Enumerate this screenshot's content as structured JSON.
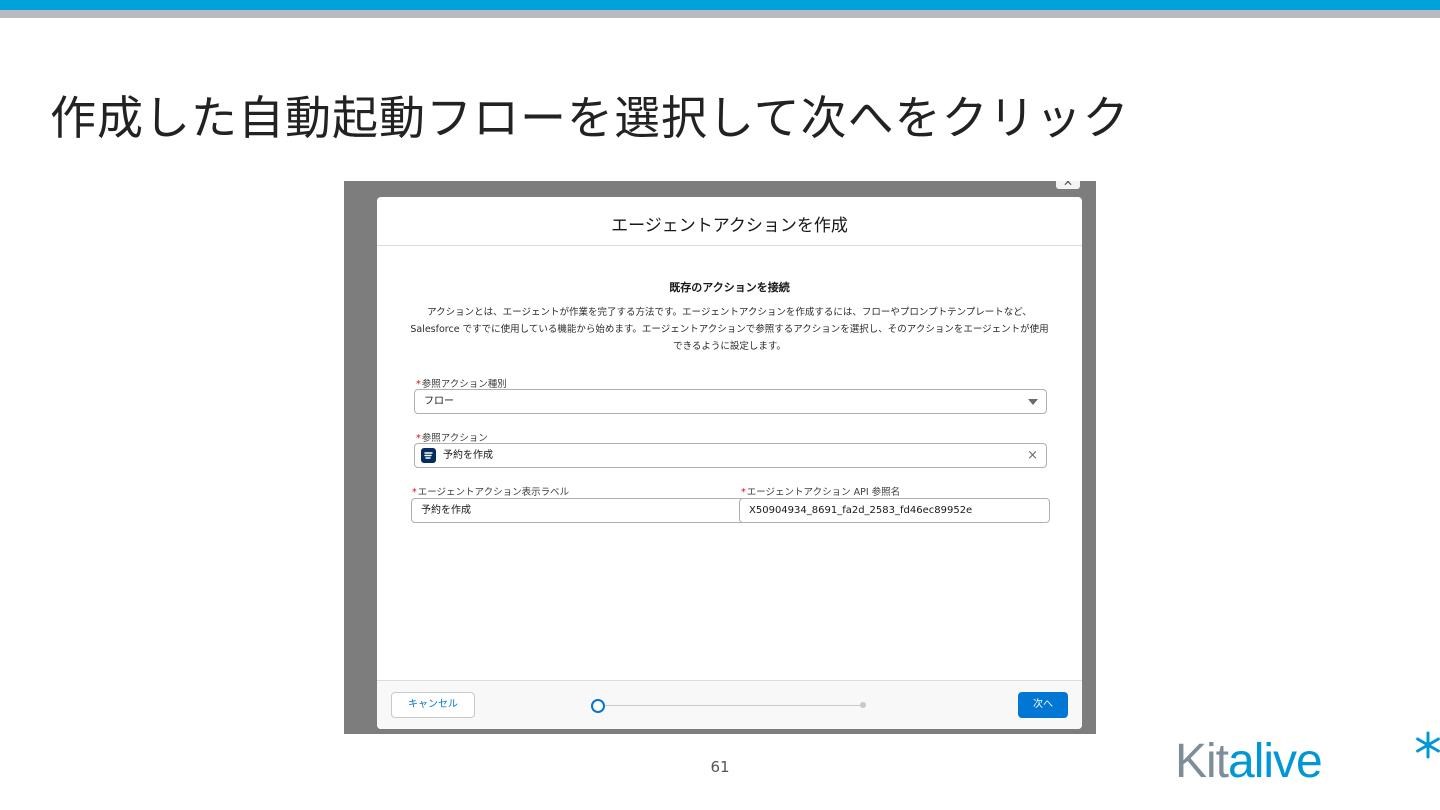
{
  "slide": {
    "title": "作成した自動起動フローを選択して次へをクリック",
    "page_number": "61",
    "logo_text_a": "Kit",
    "logo_text_b": "alive",
    "colors": {
      "top_bar": "#00a2d9",
      "accent": "#0176d3",
      "logo_gray": "#7d8e98",
      "logo_blue": "#0098d4"
    }
  },
  "modal": {
    "title": "エージェントアクションを作成",
    "section_title": "既存のアクションを接続",
    "description": "アクションとは、エージェントが作業を完了する方法です。エージェントアクションを作成するには、フローやプロンプトテンプレートなど、Salesforce ですでに使用している機能から始めます。エージェントアクションで参照するアクションを選択し、そのアクションをエージェントが使用できるように設定します。",
    "fields": {
      "ref_type": {
        "required_mark": "*",
        "label": "参照アクション種別",
        "value": "フロー"
      },
      "ref_action": {
        "required_mark": "*",
        "label": "参照アクション",
        "value": "予約を作成",
        "icon": "flow-icon",
        "clear": "×"
      },
      "display_label": {
        "required_mark": "*",
        "label": "エージェントアクション表示ラベル",
        "value": "予約を作成"
      },
      "api_name": {
        "required_mark": "*",
        "label": "エージェントアクション API 参照名",
        "value": "X50904934_8691_fa2d_2583_fd46ec89952e"
      }
    },
    "footer": {
      "cancel": "キャンセル",
      "next": "次へ",
      "progress": {
        "current_step": 1,
        "total_steps": 2
      }
    }
  }
}
